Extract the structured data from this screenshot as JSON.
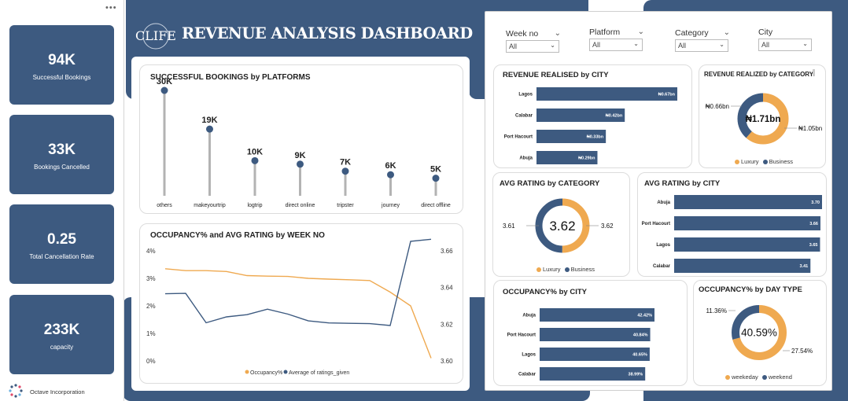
{
  "title": "REVENUE ANALYSIS DASHBOARD",
  "logo_text": "CLIFE",
  "more_icon": "more-horizontal-icon",
  "company": "Octave Incorporation",
  "colors": {
    "navy": "#3d5a80",
    "orange": "#efa950",
    "blue": "#3d5a80"
  },
  "kpis": [
    {
      "value": "94K",
      "label": "Successful Bookings"
    },
    {
      "value": "33K",
      "label": "Bookings Cancelled"
    },
    {
      "value": "0.25",
      "label": "Total Cancellation Rate"
    },
    {
      "value": "233K",
      "label": "capacity"
    }
  ],
  "slicers": [
    {
      "label": "Week no",
      "value": "All"
    },
    {
      "label": "Platform",
      "value": "All"
    },
    {
      "label": "Category",
      "value": "All"
    },
    {
      "label": "City",
      "value": "All"
    }
  ],
  "chart_data": [
    {
      "id": "bookings_by_platform",
      "type": "lollipop",
      "title": "SUCCESSFUL BOOKINGS by PLATFORMS",
      "categories": [
        "others",
        "makeyourtrip",
        "logtrip",
        "direct online",
        "tripster",
        "journey",
        "direct offline"
      ],
      "values": [
        30,
        19,
        10,
        9,
        7,
        6,
        5
      ],
      "labels": [
        "30K",
        "19K",
        "10K",
        "9K",
        "7K",
        "6K",
        "5K"
      ]
    },
    {
      "id": "occupancy_rating_by_week",
      "type": "line",
      "title": "OCCUPANCY% and AVG RATING by WEEK NO",
      "y_left_ticks": [
        "4%",
        "3%",
        "2%",
        "1%",
        "0%"
      ],
      "y_left_range": [
        0,
        4
      ],
      "y_right_ticks": [
        "3.66",
        "3.64",
        "3.62",
        "3.60"
      ],
      "y_right_range": [
        3.6,
        3.66
      ],
      "series": [
        {
          "name": "Occupancy%",
          "axis": "left",
          "color": "#efa950",
          "values": [
            3.35,
            3.28,
            3.28,
            3.25,
            3.1,
            3.08,
            3.07,
            3.0,
            2.97,
            2.95,
            2.92,
            2.5,
            2.0,
            0.1
          ]
        },
        {
          "name": "Average of ratings_given",
          "axis": "right",
          "color": "#3d5a80",
          "values": [
            3.6366,
            3.6368,
            3.6208,
            3.624,
            3.6252,
            3.6282,
            3.6255,
            3.6218,
            3.6207,
            3.6205,
            3.6203,
            3.6193,
            3.6652,
            3.6663
          ]
        }
      ]
    },
    {
      "id": "revenue_by_city",
      "type": "bar",
      "orientation": "horizontal",
      "title": "REVENUE REALISED by CITY",
      "categories": [
        "Lagos",
        "Calabar",
        "Port Hacourt",
        "Abuja"
      ],
      "values": [
        0.67,
        0.42,
        0.33,
        0.29
      ],
      "labels": [
        "₦0.67bn",
        "₦0.42bn",
        "₦0.33bn",
        "₦0.29bn"
      ]
    },
    {
      "id": "revenue_by_category",
      "type": "pie",
      "donut": true,
      "title": "REVENUE REALIZED by CATEGORY",
      "center": "₦1.71bn",
      "categories": [
        "Luxury",
        "Business"
      ],
      "values": [
        1.05,
        0.66
      ],
      "labels": [
        "₦1.05bn",
        "₦0.66bn"
      ]
    },
    {
      "id": "avg_rating_by_category",
      "type": "pie",
      "donut": true,
      "title": "AVG RATING by CATEGORY",
      "center": "3.62",
      "categories": [
        "Luxury",
        "Business"
      ],
      "values": [
        3.62,
        3.61
      ],
      "labels": [
        "3.62",
        "3.61"
      ]
    },
    {
      "id": "avg_rating_by_city",
      "type": "bar",
      "orientation": "horizontal",
      "title": "AVG RATING by CITY",
      "categories": [
        "Abuja",
        "Port Hacourt",
        "Lagos",
        "Calabar"
      ],
      "values": [
        3.7,
        3.66,
        3.65,
        3.41
      ],
      "labels": [
        "3.70",
        "3.66",
        "3.65",
        "3.41"
      ]
    },
    {
      "id": "occupancy_by_city",
      "type": "bar",
      "orientation": "horizontal",
      "title": "OCCUPANCY% by CITY",
      "categories": [
        "Abuja",
        "Port Hacourt",
        "Lagos",
        "Calabar"
      ],
      "values": [
        42.42,
        40.84,
        40.65,
        38.99
      ],
      "labels": [
        "42.42%",
        "40.84%",
        "40.65%",
        "38.99%"
      ]
    },
    {
      "id": "occupancy_by_day_type",
      "type": "pie",
      "donut": true,
      "title": "OCCUPANCY% by DAY TYPE",
      "center": "40.59%",
      "categories": [
        "weekeday",
        "weekend"
      ],
      "values": [
        27.54,
        11.36
      ],
      "labels": [
        "27.54%",
        "11.36%"
      ]
    }
  ]
}
